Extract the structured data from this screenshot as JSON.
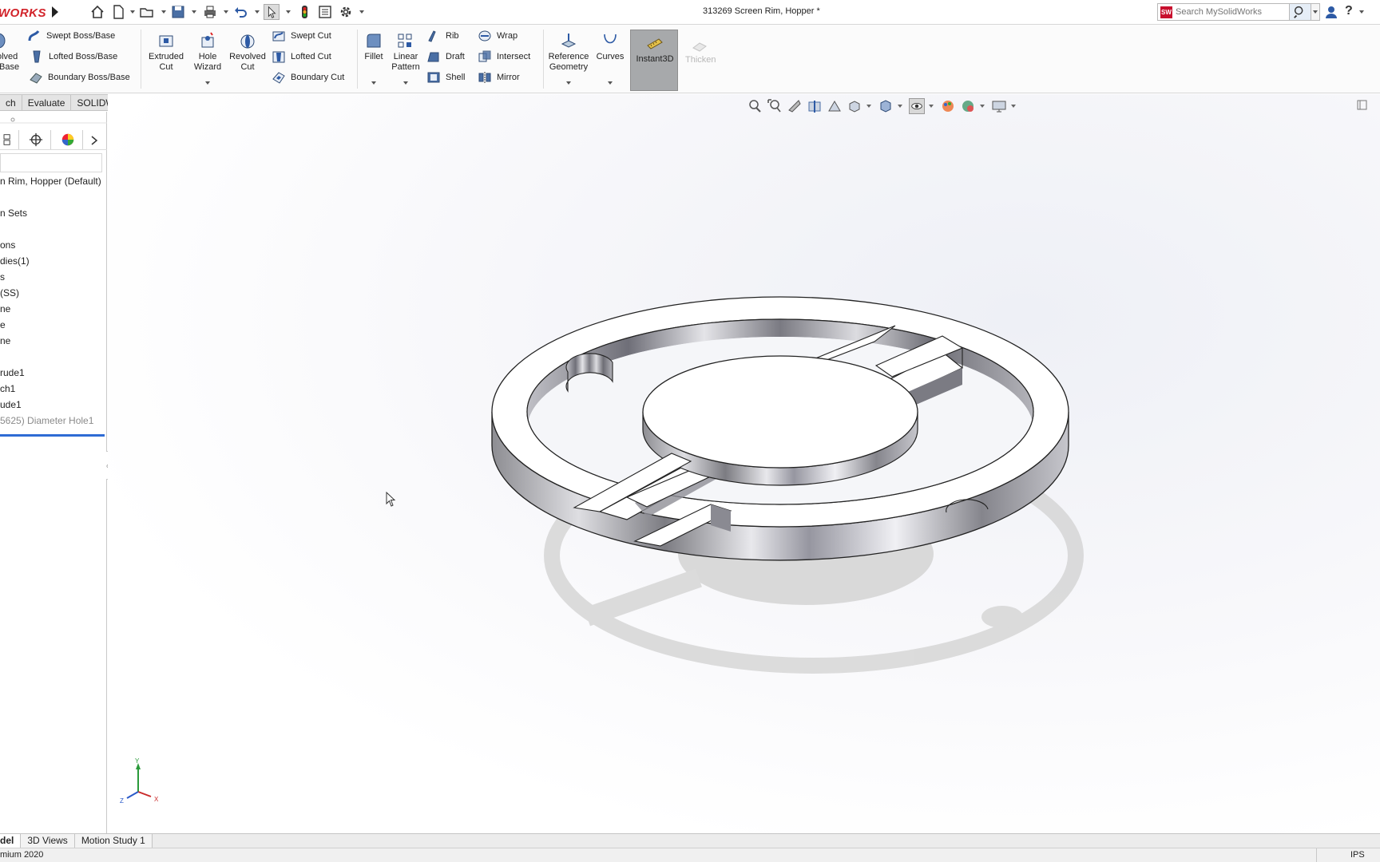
{
  "app": {
    "logo_text": "WORKS",
    "document_title": "313269 Screen Rim, Hopper *"
  },
  "search": {
    "placeholder": "Search MySolidWorks",
    "logo_text": "MY\nSW"
  },
  "help": {
    "label": "?"
  },
  "ribbon": {
    "revolved_boss": "olved\n/Base",
    "swept_boss": "Swept Boss/Base",
    "lofted_boss": "Lofted Boss/Base",
    "boundary_boss": "Boundary Boss/Base",
    "extruded_cut": "Extruded\nCut",
    "hole_wizard": "Hole\nWizard",
    "revolved_cut": "Revolved\nCut",
    "swept_cut": "Swept Cut",
    "lofted_cut": "Lofted Cut",
    "boundary_cut": "Boundary Cut",
    "fillet": "Fillet",
    "linear_pattern": "Linear\nPattern",
    "rib": "Rib",
    "draft": "Draft",
    "shell": "Shell",
    "wrap": "Wrap",
    "intersect": "Intersect",
    "mirror": "Mirror",
    "reference_geometry": "Reference\nGeometry",
    "curves": "Curves",
    "instant3d": "Instant3D",
    "thicken": "Thicken"
  },
  "cm_tabs": [
    "ch",
    "Evaluate",
    "SOLIDWORKS Add-Ins"
  ],
  "tree": {
    "root": "n Rim, Hopper  (Default)",
    "items": [
      {
        "label": "n Sets",
        "dim": false
      },
      {
        "label": "ons",
        "dim": false
      },
      {
        "label": "dies(1)",
        "dim": false
      },
      {
        "label": "s",
        "dim": false
      },
      {
        "label": "(SS)",
        "dim": false
      },
      {
        "label": "ne",
        "dim": false
      },
      {
        "label": "e",
        "dim": false
      },
      {
        "label": "ne",
        "dim": false
      },
      {
        "label": "rude1",
        "dim": false
      },
      {
        "label": "ch1",
        "dim": false
      },
      {
        "label": "ude1",
        "dim": false
      },
      {
        "label": "5625) Diameter Hole1",
        "dim": true
      }
    ]
  },
  "triad": {
    "y": "Y",
    "z": "Z",
    "x": "X"
  },
  "bottom_tabs": [
    {
      "label": "del",
      "active": true
    },
    {
      "label": "3D Views",
      "active": false
    },
    {
      "label": "Motion Study 1",
      "active": false
    }
  ],
  "status": {
    "left": "mium 2020",
    "units": "IPS"
  },
  "colors": {
    "brand": "#d2232a",
    "instant3d_active": "#a7a9ab",
    "rollback_bar": "#2e6bd4"
  }
}
